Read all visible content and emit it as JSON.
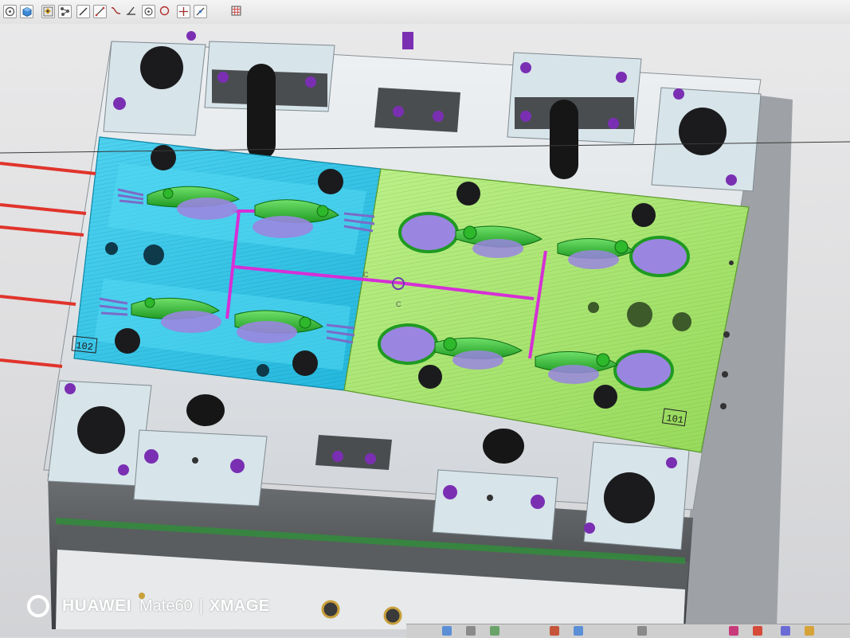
{
  "toolbar": {
    "icons": [
      "perspective-view-icon",
      "solid-cube-icon",
      "display-style-icon",
      "part-tree-icon",
      "line-icon",
      "sketch-line-icon",
      "spline-icon",
      "angle-icon",
      "circle-center-icon",
      "circle-icon",
      "crosshair-icon",
      "edit-line-icon",
      "grid-icon"
    ]
  },
  "model": {
    "plate_labels": [
      "102",
      "101"
    ],
    "runner_marker": "C"
  },
  "colors": {
    "cavity_left": "#2fc7e8",
    "cavity_right": "#a6e46a",
    "part_green": "#2eb82b",
    "part_purple": "#9a86e0",
    "runner": "#d62fd6",
    "screw": "#7a2fb3",
    "mold_base": "#d7e4ea"
  },
  "watermark": {
    "brand": "HUAWEI",
    "model": "Mate60",
    "separator": "|",
    "mark": "XMAGE"
  }
}
